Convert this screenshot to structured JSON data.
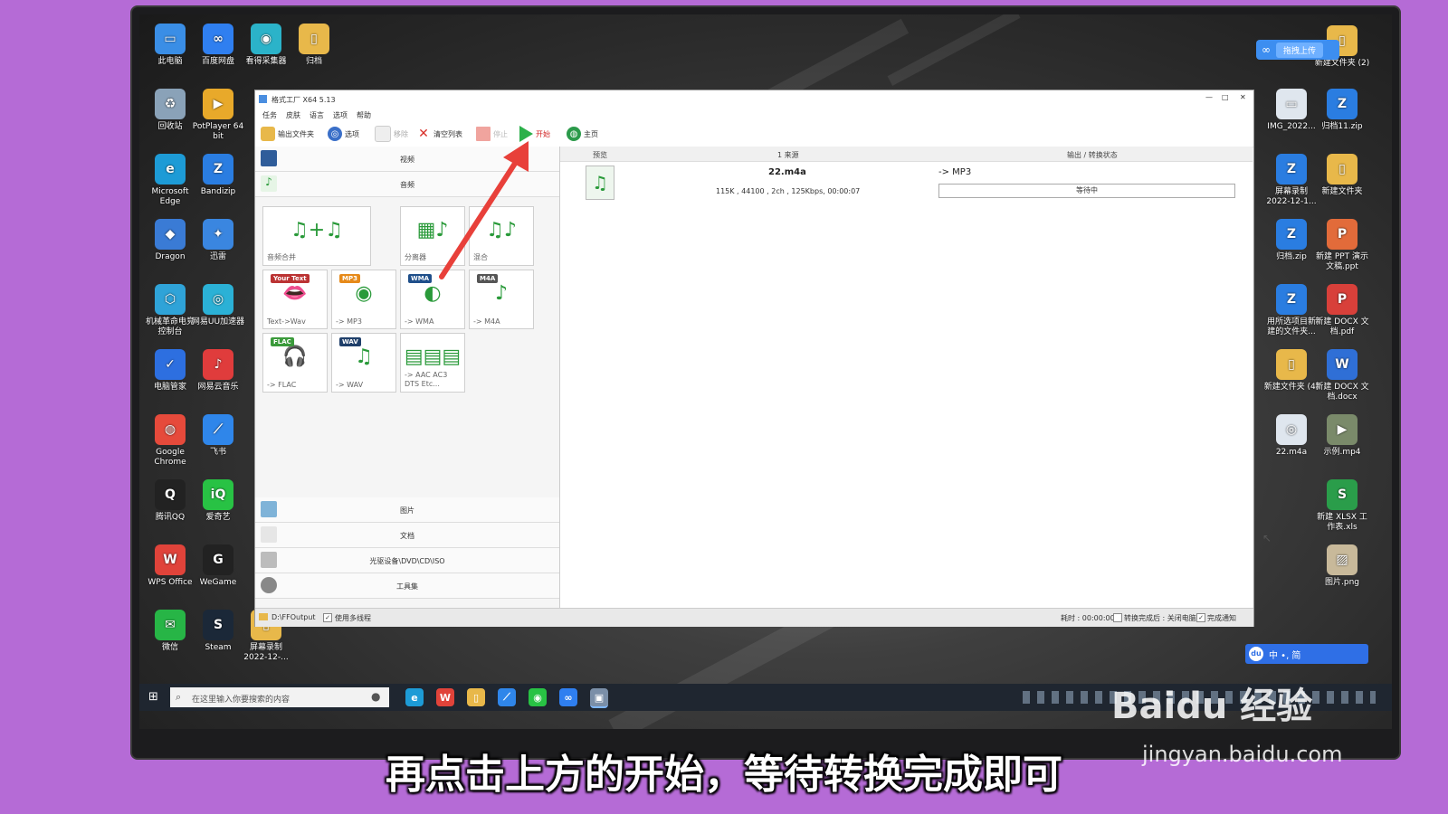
{
  "window": {
    "title": "格式工厂 X64 5.13",
    "menu": [
      "任务",
      "皮肤",
      "语言",
      "选项",
      "帮助"
    ],
    "toolbar": {
      "output_folder": "输出文件夹",
      "options": "选项",
      "remove": "移除",
      "clear_list": "清空列表",
      "stop": "停止",
      "start": "开始",
      "home": "主页"
    },
    "categories_top": [
      "视频",
      "音频"
    ],
    "audio_tiles": [
      {
        "label": "音频合并",
        "icon": "music-plus-icon"
      },
      {
        "label": "分离器",
        "icon": "film-music-icon"
      },
      {
        "label": "混合",
        "icon": "music-mix-icon"
      },
      {
        "label": "Text->Wav",
        "badge": "Your Text",
        "icon": "mouth-icon"
      },
      {
        "label": "-> MP3",
        "badge": "MP3",
        "icon": "speaker-icon"
      },
      {
        "label": "-> WMA",
        "badge": "WMA",
        "icon": "disc-icon"
      },
      {
        "label": "-> M4A",
        "badge": "M4A",
        "icon": "note-file-icon"
      },
      {
        "label": "-> FLAC",
        "badge": "FLAC",
        "icon": "headphones-icon"
      },
      {
        "label": "-> WAV",
        "badge": "WAV",
        "icon": "note-icon"
      },
      {
        "label": "-> AAC AC3 DTS Etc...",
        "icon": "formats-icon"
      }
    ],
    "categories_bottom": [
      "图片",
      "文档",
      "光驱设备\\DVD\\CD\\ISO",
      "工具集"
    ],
    "columns": [
      "预览",
      "1 来源",
      "输出 / 转换状态"
    ],
    "task": {
      "filename": "22.m4a",
      "info": "115K , 44100 , 2ch , 125Kbps, 00:00:07",
      "output": "-> MP3",
      "status": "等待中"
    },
    "statusbar": {
      "output_path": "D:\\FFOutput",
      "multithread": "使用多线程",
      "elapsed": "耗时 : 00:00:00",
      "after_convert": "转换完成后 : 关闭电脑",
      "notify": "完成通知"
    }
  },
  "desktop_left": [
    {
      "label": "此电脑",
      "color": "#3a8ee6",
      "glyph": "▭"
    },
    {
      "label": "百度网盘",
      "color": "#2f7ff0",
      "glyph": "∞"
    },
    {
      "label": "看得采集器",
      "color": "#2bb3c9",
      "glyph": "◉"
    },
    {
      "label": "归档",
      "color": "#e8b84a",
      "glyph": "▯"
    },
    {
      "label": "回收站",
      "color": "#8aa2b8",
      "glyph": "♻"
    },
    {
      "label": "PotPlayer 64 bit",
      "color": "#e8a92a",
      "glyph": "▶"
    },
    {
      "label": "Microsoft Edge",
      "color": "#1d9bd6",
      "glyph": "e"
    },
    {
      "label": "Bandizip",
      "color": "#2a7de1",
      "glyph": "Z"
    },
    {
      "label": "Dragon",
      "color": "#3a7bd5",
      "glyph": "◆"
    },
    {
      "label": "迅雷",
      "color": "#3a86e0",
      "glyph": "✦"
    },
    {
      "label": "机械革命电竞控制台",
      "color": "#2fa3d8",
      "glyph": "⬡"
    },
    {
      "label": "网易UU加速器",
      "color": "#2bb1d6",
      "glyph": "◎"
    },
    {
      "label": "电脑管家",
      "color": "#2d6fe0",
      "glyph": "✓"
    },
    {
      "label": "网易云音乐",
      "color": "#e03c3c",
      "glyph": "♪"
    },
    {
      "label": "Google Chrome",
      "color": "#e64a3b",
      "glyph": "◍"
    },
    {
      "label": "飞书",
      "color": "#2f86ea",
      "glyph": "⟋"
    },
    {
      "label": "腾讯QQ",
      "color": "#222222",
      "glyph": "Q"
    },
    {
      "label": "爱奇艺",
      "color": "#28c244",
      "glyph": "iQ"
    },
    {
      "label": "WPS Office",
      "color": "#e0433a",
      "glyph": "W"
    },
    {
      "label": "WeGame",
      "color": "#222222",
      "glyph": "G"
    },
    {
      "label": "微信",
      "color": "#27b546",
      "glyph": "✉"
    },
    {
      "label": "Steam",
      "color": "#1b2838",
      "glyph": "S"
    },
    {
      "label": "屏幕录制 2022-12-...",
      "color": "#e8b84a",
      "glyph": "▯"
    }
  ],
  "desktop_right": [
    {
      "label": "新建文件夹 (2)",
      "color": "#e8b84a",
      "glyph": "▯"
    },
    {
      "label": "IMG_2022...",
      "color": "#dfe6ee",
      "glyph": "▭"
    },
    {
      "label": "归档11.zip",
      "color": "#2a7de1",
      "glyph": "Z"
    },
    {
      "label": "屏幕录制 2022-12-1...",
      "color": "#2a7de1",
      "glyph": "Z"
    },
    {
      "label": "新建文件夹",
      "color": "#e8b84a",
      "glyph": "▯"
    },
    {
      "label": "归档.zip",
      "color": "#2a7de1",
      "glyph": "Z"
    },
    {
      "label": "新建 PPT 演示文稿.ppt",
      "color": "#e26b3a",
      "glyph": "P"
    },
    {
      "label": "用所选项目新建的文件夹...",
      "color": "#2a7de1",
      "glyph": "Z"
    },
    {
      "label": "新建 DOCX 文档.pdf",
      "color": "#d8403a",
      "glyph": "P"
    },
    {
      "label": "新建文件夹 (4)",
      "color": "#e8b84a",
      "glyph": "▯"
    },
    {
      "label": "新建 DOCX 文档.docx",
      "color": "#2f6fd6",
      "glyph": "W"
    },
    {
      "label": "22.m4a",
      "color": "#dfe6ee",
      "glyph": "◎"
    },
    {
      "label": "示例.mp4",
      "color": "#7a8a6a",
      "glyph": "▶"
    },
    {
      "label": "新建 XLSX 工作表.xls",
      "color": "#2a9d4a",
      "glyph": "S"
    },
    {
      "label": "图片.png",
      "color": "#c8b99a",
      "glyph": "▨"
    }
  ],
  "cloud_upload": "拖拽上传",
  "taskbar": {
    "search_placeholder": "在这里输入你要搜索的内容",
    "ime": "中 •, 简"
  },
  "subtitle": "再点击上方的开始，等待转换完成即可",
  "watermark": {
    "logo": "Baidu 经验",
    "url": "jingyan.baidu.com"
  },
  "colors": {
    "start_green": "#2bb04a",
    "arrow_red": "#e8403a",
    "purple_bg": "#b56bd6"
  }
}
